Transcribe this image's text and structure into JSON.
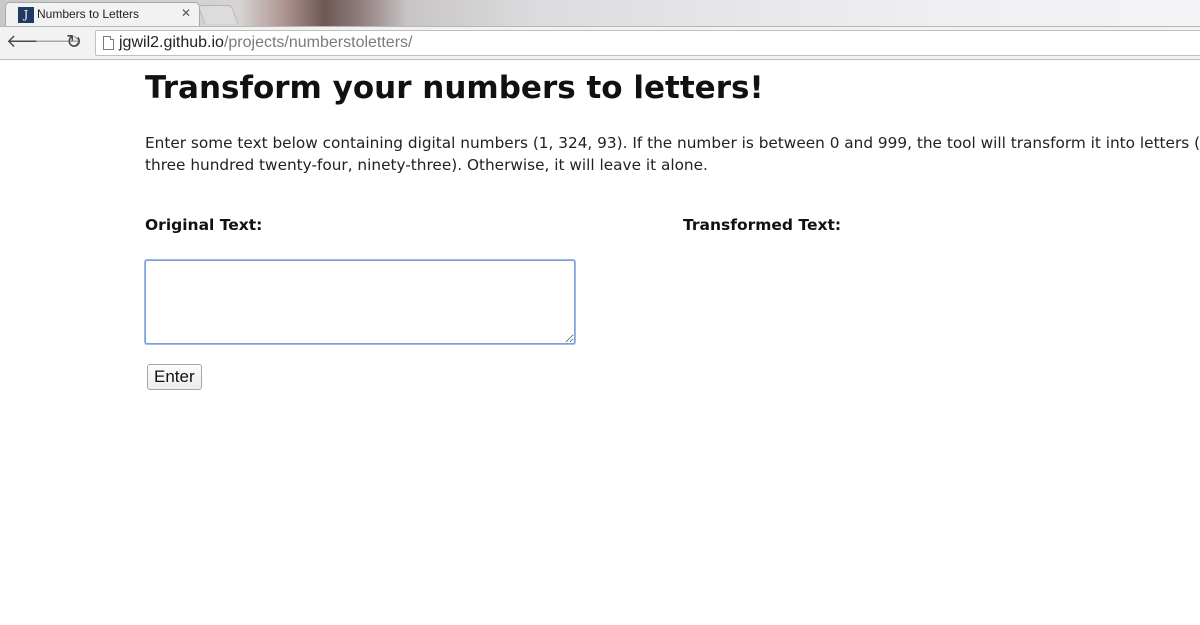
{
  "browser": {
    "tab": {
      "favicon_letter": "J",
      "title": "Numbers to Letters",
      "close_glyph": "✕"
    },
    "nav": {
      "back_glyph": "🡐",
      "forward_glyph": "🡒",
      "reload_glyph": "↻"
    },
    "address": {
      "host": "jgwil2.github.io",
      "path": "/projects/numberstoletters/"
    },
    "icons": [
      "back-arrow-icon",
      "forward-arrow-icon",
      "reload-icon",
      "page-icon",
      "close-icon"
    ]
  },
  "page": {
    "title": "Transform your numbers to letters!",
    "intro": "Enter some text below containing digital numbers (1, 324, 93). If the number is between 0 and 999, the tool will transform it into letters (one, three hundred twenty-four, ninety-three). Otherwise, it will leave it alone.",
    "original_label": "Original Text:",
    "transformed_label": "Transformed Text:",
    "original_value": "",
    "transformed_value": "",
    "enter_label": "Enter"
  },
  "colors": {
    "favicon_bg": "#1f3b63",
    "input_focus_border": "#7ea1d4",
    "chrome_toolbar": "#f2f2f2"
  }
}
